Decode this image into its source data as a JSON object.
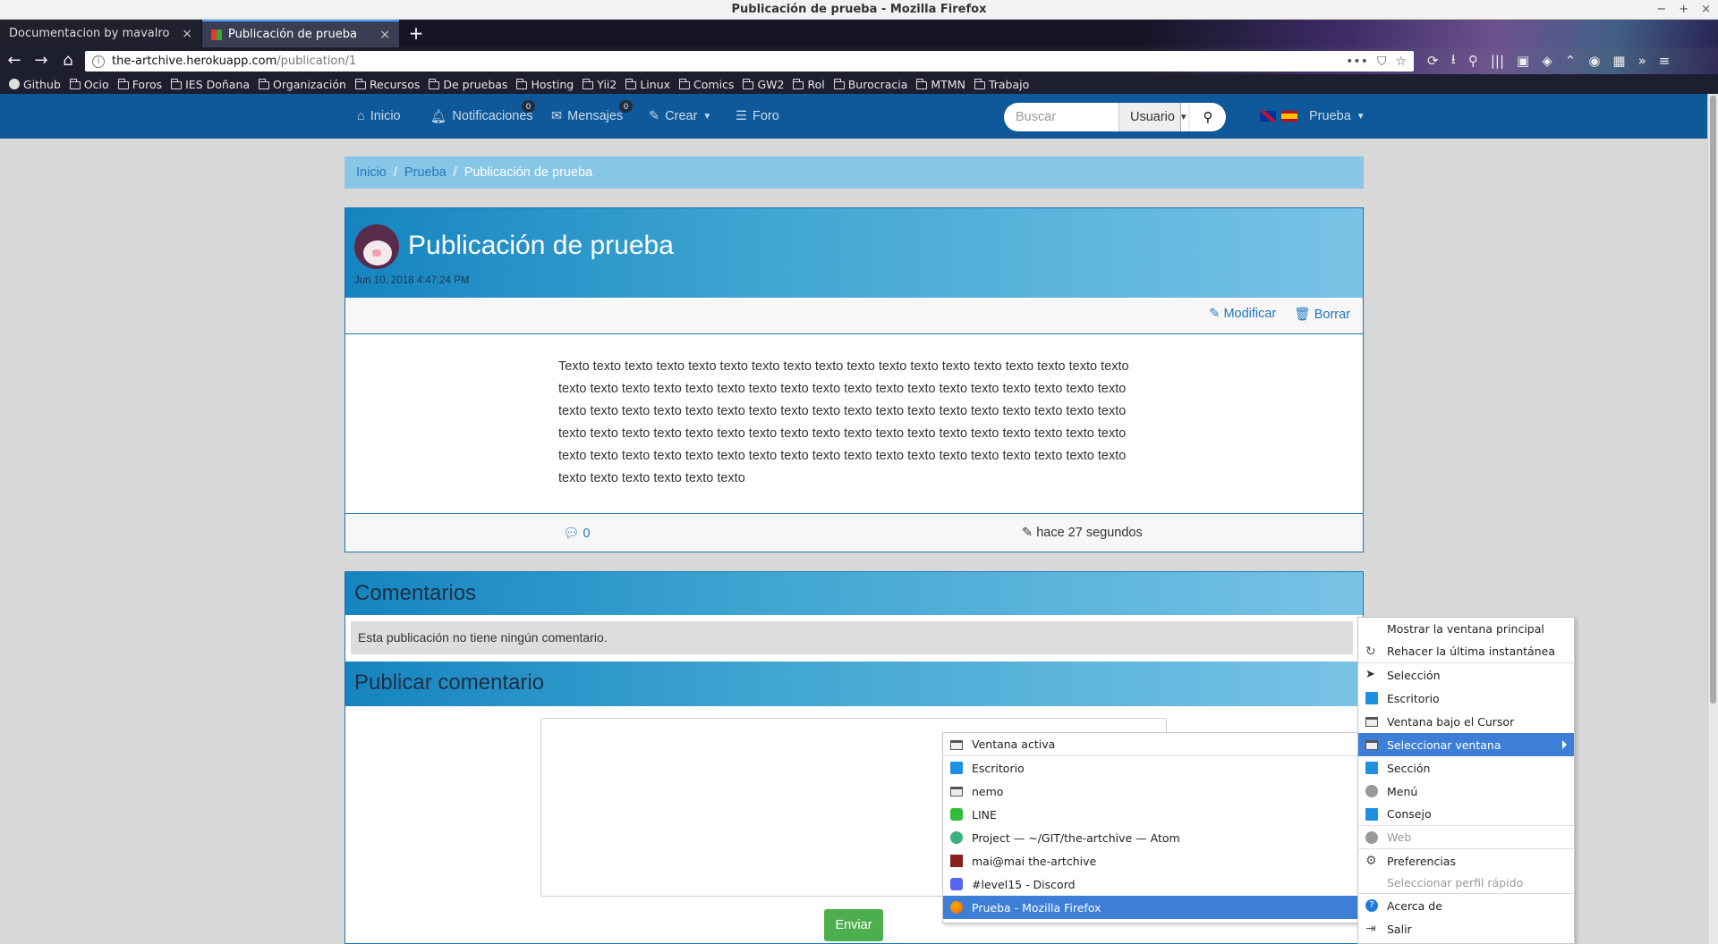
{
  "window": {
    "title": "Publicación de prueba - Mozilla Firefox",
    "controls": [
      "−",
      "+",
      "×"
    ]
  },
  "tabs": [
    {
      "title": "Documentacion by mavalro",
      "close": "×"
    },
    {
      "title": "Publicación de prueba",
      "close": "×"
    }
  ],
  "newtab": "+",
  "url": {
    "host": "the-artchive.herokuapp.com",
    "path": "/publication/1",
    "info": "i"
  },
  "url_actions": [
    "•••",
    "⛉",
    "☆"
  ],
  "nav_icons": [
    "⟳",
    "⭳",
    "⚲",
    "|||",
    "▣",
    "◈",
    "⌃",
    "◉",
    "▦",
    "»",
    "≡"
  ],
  "nav_buttons": {
    "back": "←",
    "forward": "→",
    "home": "⌂"
  },
  "bookmarks": [
    "Github",
    "Ocio",
    "Foros",
    "IES Doñana",
    "Organización",
    "Recursos",
    "De pruebas",
    "Hosting",
    "Yii2",
    "Linux",
    "Comics",
    "GW2",
    "Rol",
    "Burocracia",
    "MTMN",
    "Trabajo"
  ],
  "sitenav": {
    "home": "Inicio",
    "notifications": "Notificaciones",
    "notifications_count": "0",
    "messages": "Mensajes",
    "messages_count": "0",
    "create": "Crear",
    "forum": "Foro",
    "search_placeholder": "Buscar",
    "search_type": "Usuario",
    "user": "Prueba"
  },
  "breadcrumb": {
    "home": "Inicio",
    "parent": "Prueba",
    "current": "Publicación de prueba",
    "sep": "/"
  },
  "post": {
    "title": "Publicación de prueba",
    "date": "Jun 10, 2018 4:47:24 PM",
    "edit": "Modificar",
    "delete": "Borrar",
    "body": "Texto texto texto texto texto texto texto texto texto texto texto texto texto texto texto texto texto texto texto texto texto texto texto texto texto texto texto texto texto texto texto texto texto texto texto texto texto texto texto texto texto texto texto texto texto texto texto texto texto texto texto texto texto texto texto texto texto texto texto texto texto texto texto texto texto texto texto texto texto texto texto texto texto texto texto texto texto texto texto texto texto texto texto texto texto texto texto texto texto texto texto texto texto texto texto texto",
    "comment_count": "0",
    "edited": "hace 27 segundos"
  },
  "comments": {
    "title": "Comentarios",
    "empty": "Esta publicación no tiene ningún comentario.",
    "publish_title": "Publicar comentario",
    "send": "Enviar"
  },
  "submenu": [
    {
      "label": "Ventana activa",
      "icon": "window-icon"
    },
    {
      "label": "Escritorio",
      "icon": "desktop-icon"
    },
    {
      "label": "nemo",
      "icon": "window-icon"
    },
    {
      "label": "LINE",
      "icon": "line-icon"
    },
    {
      "label": "Project — ~/GIT/the-artchive — Atom",
      "icon": "atom-icon"
    },
    {
      "label": "mai@mai the-artchive",
      "icon": "terminal-icon"
    },
    {
      "label": "#level15 - Discord",
      "icon": "discord-icon"
    },
    {
      "label": "Prueba - Mozilla Firefox",
      "icon": "firefox-icon"
    }
  ],
  "mainmenu": [
    {
      "label": "Mostrar la ventana principal"
    },
    {
      "label": "Rehacer la última instantánea"
    },
    {
      "label": "Selección"
    },
    {
      "label": "Escritorio"
    },
    {
      "label": "Ventana bajo el Cursor"
    },
    {
      "label": "Seleccionar ventana"
    },
    {
      "label": "Sección"
    },
    {
      "label": "Menú"
    },
    {
      "label": "Consejo"
    },
    {
      "label": "Web"
    },
    {
      "label": "Preferencias"
    },
    {
      "label": "Seleccionar perfil rápido"
    },
    {
      "label": "Acerca de"
    },
    {
      "label": "Salir"
    }
  ]
}
